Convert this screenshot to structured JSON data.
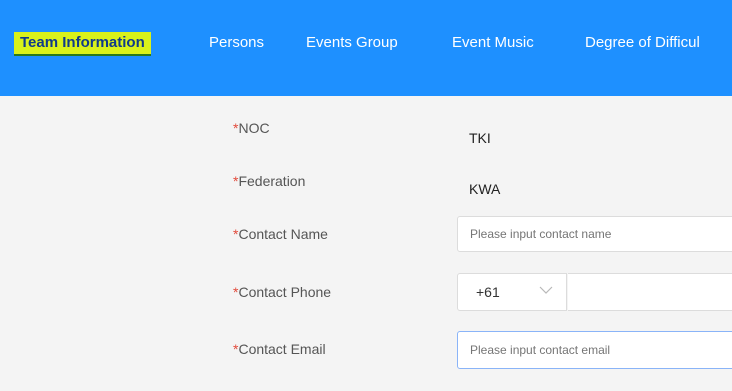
{
  "nav": {
    "tabs": [
      {
        "label": "Team Information",
        "active": true
      },
      {
        "label": "Persons"
      },
      {
        "label": "Events Group"
      },
      {
        "label": "Event Music"
      },
      {
        "label": "Degree of Difficul"
      }
    ]
  },
  "form": {
    "required_mark": "*",
    "noc": {
      "label": "NOC",
      "value": "TKI"
    },
    "federation": {
      "label": "Federation",
      "value": "KWA"
    },
    "contact_name": {
      "label": "Contact Name",
      "placeholder": "Please input contact name"
    },
    "contact_phone": {
      "label": "Contact Phone",
      "code": "+61",
      "icon": "chevron-down-icon"
    },
    "contact_email": {
      "label": "Contact Email",
      "placeholder": "Please input contact email"
    }
  },
  "colors": {
    "nav_background": "#1e90ff",
    "active_tab_highlight": "#d9f21a",
    "required": "#e24a3b"
  }
}
